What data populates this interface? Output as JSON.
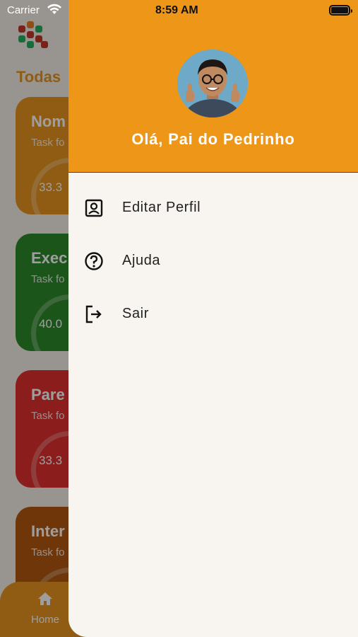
{
  "status_bar": {
    "carrier": "Carrier",
    "time": "8:59 AM"
  },
  "background": {
    "title": "Todas",
    "cards": [
      {
        "title": "Nom",
        "subtitle": "Task fo",
        "percent": "33.3"
      },
      {
        "title": "Exec",
        "subtitle": "Task fo",
        "percent": "40.0"
      },
      {
        "title": "Pare",
        "subtitle": "Task fo",
        "percent": "33.3"
      },
      {
        "title": "Inter",
        "subtitle": "Task fo",
        "percent": ""
      }
    ],
    "bottom_nav": {
      "home_label": "Home"
    }
  },
  "drawer": {
    "greeting": "Olá, Pai do Pedrinho",
    "menu": [
      {
        "label": "Editar Perfil",
        "icon": "profile-icon"
      },
      {
        "label": "Ajuda",
        "icon": "help-icon"
      },
      {
        "label": "Sair",
        "icon": "logout-icon"
      }
    ]
  },
  "colors": {
    "accent": "#ed9617",
    "drawer_bg": "#f8f5f0",
    "card_green": "#2e8a2a",
    "card_red": "#e0302e",
    "card_brown": "#b35a10"
  }
}
